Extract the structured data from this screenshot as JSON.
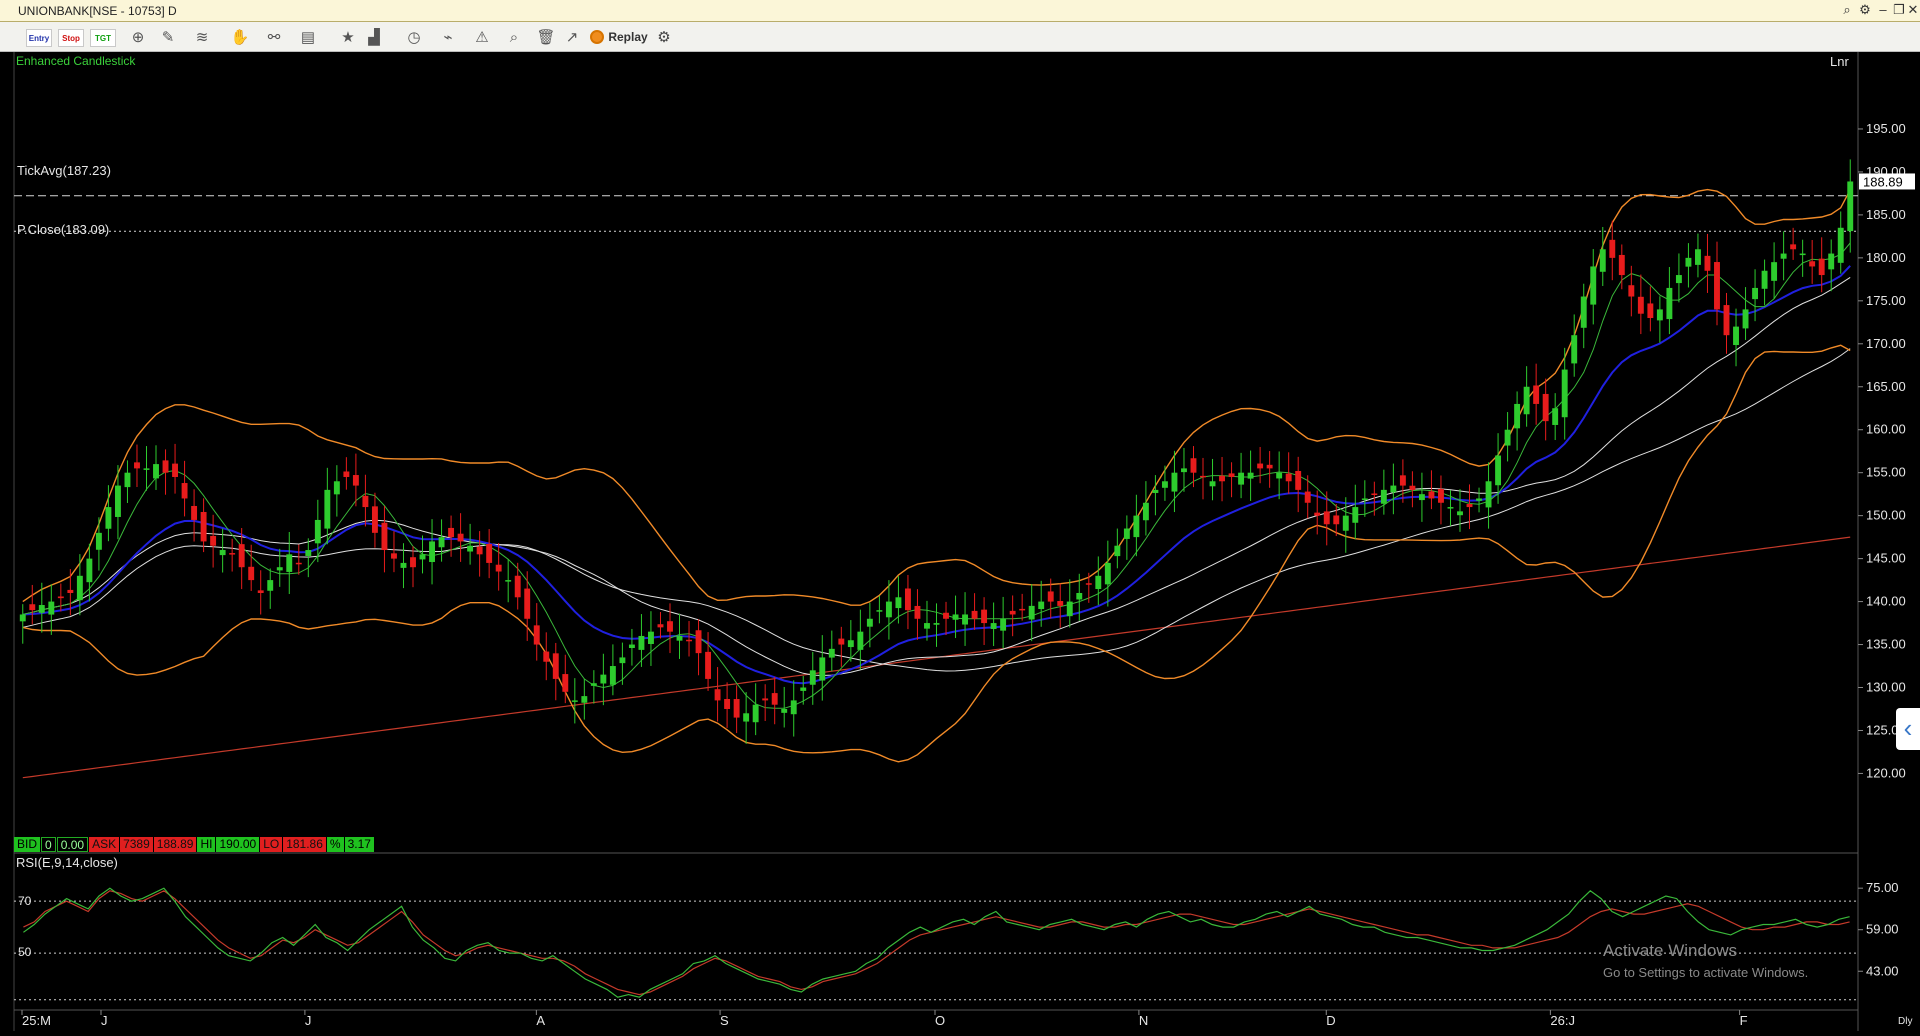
{
  "window": {
    "title": "UNIONBANK[NSE - 10753] D",
    "controls": [
      "search-icon",
      "settings-icon",
      "minimize-icon",
      "restore-icon",
      "close-icon"
    ]
  },
  "toolbar": {
    "entry_label": "Entry",
    "stop_label": "Stop",
    "target_label": "TGT",
    "replay_label": "Replay",
    "icons": [
      "crosshair-icon",
      "draw-line-icon",
      "fib-icon",
      "pan-icon",
      "link-icon",
      "template-icon",
      "favorite-icon",
      "indicator-icon",
      "clock-icon",
      "signal-icon",
      "alert-icon",
      "zoom-icon",
      "delete-icon",
      "trend-icon",
      "settings-gear-icon"
    ]
  },
  "chart_header": {
    "study_title": "Enhanced Candlestick",
    "scale_mode": "Lnr",
    "tick_avg_label": "TickAvg(187.23)",
    "prev_close_label": "P.Close(183.09)",
    "last_price_tag": "188.89"
  },
  "quote": {
    "bid_label": "BID",
    "bid_qty": "0",
    "bid_price": "0.00",
    "ask_label": "ASK",
    "ask_qty": "7389",
    "ask_price": "188.89",
    "hi_label": "HI",
    "hi_value": "190.00",
    "lo_label": "LO",
    "lo_value": "181.86",
    "pct_label": "%",
    "pct_value": "3.17"
  },
  "rsi": {
    "label": "RSI(E,9,14,close)",
    "level_70_label": "70",
    "level_50_label": "50"
  },
  "watermark": {
    "line1": "Activate Windows",
    "line2": "Go to Settings to activate Windows."
  },
  "timeframe_badge": "Dly",
  "colors": {
    "up": "#2ecc2e",
    "down": "#e81c1c",
    "bollinger": "#f08a28",
    "ema_blue": "#2020e0",
    "ma_white": "#e0e0e0",
    "ma_green": "#3ab83a",
    "ma_long_red": "#c43a2a",
    "rsi_green": "#3ab83a",
    "rsi_red": "#c43a2a"
  },
  "chart_data": [
    {
      "type": "candlestick",
      "y_ticks": [
        "120.00",
        "125.00",
        "130.00",
        "135.00",
        "140.00",
        "145.00",
        "150.00",
        "155.00",
        "160.00",
        "165.00",
        "170.00",
        "175.00",
        "180.00",
        "185.00",
        "190.00",
        "195.00"
      ],
      "ylim": [
        114,
        200
      ],
      "x_ticks": [
        "25:M",
        "J",
        "J",
        "A",
        "S",
        "O",
        "N",
        "D",
        "26:J",
        "F"
      ],
      "reference_lines": {
        "tick_avg": 187.23,
        "prev_close": 183.09
      },
      "close": [
        138.5,
        139.0,
        139.6,
        140.0,
        140.4,
        141.0,
        143.0,
        145.0,
        148.0,
        151.0,
        153.5,
        155.0,
        155.5,
        155.5,
        156.0,
        155.0,
        154.5,
        152.0,
        149.5,
        147.0,
        146.5,
        146.0,
        145.5,
        144.0,
        142.5,
        141.0,
        142.5,
        144.0,
        145.5,
        144.5,
        146.0,
        149.5,
        153.0,
        154.0,
        154.5,
        153.5,
        151.0,
        148.0,
        146.0,
        145.0,
        144.5,
        144.0,
        145.5,
        147.0,
        147.5,
        147.5,
        147.0,
        146.5,
        145.5,
        144.5,
        143.5,
        142.5,
        140.5,
        138.0,
        135.0,
        133.0,
        131.0,
        129.5,
        128.5,
        129.0,
        130.5,
        131.5,
        132.5,
        133.5,
        135.0,
        136.0,
        136.5,
        137.0,
        136.5,
        136.0,
        135.5,
        134.0,
        131.0,
        128.5,
        127.5,
        126.5,
        127.0,
        128.0,
        128.5,
        128.0,
        127.5,
        128.5,
        130.0,
        132.0,
        133.5,
        134.5,
        135.0,
        135.5,
        136.5,
        138.0,
        139.0,
        140.0,
        140.5,
        139.0,
        138.0,
        137.5,
        137.5,
        138.0,
        138.5,
        138.5,
        138.0,
        137.5,
        137.5,
        138.0,
        138.5,
        139.0,
        139.5,
        140.0,
        140.0,
        139.5,
        140.0,
        141.0,
        142.0,
        143.0,
        144.5,
        146.5,
        148.5,
        150.0,
        151.5,
        153.0,
        154.0,
        155.0,
        155.5,
        155.0,
        154.5,
        154.0,
        154.0,
        154.5,
        155.0,
        155.0,
        155.5,
        155.5,
        155.0,
        154.0,
        153.0,
        151.5,
        150.0,
        149.0,
        149.0,
        150.0,
        151.0,
        152.0,
        152.5,
        153.0,
        153.5,
        153.5,
        153.0,
        152.5,
        152.0,
        151.5,
        151.0,
        150.5,
        151.0,
        152.0,
        154.0,
        157.0,
        160.0,
        163.0,
        165.0,
        163.0,
        161.0,
        162.5,
        167.0,
        171.0,
        175.5,
        179.0,
        181.0,
        180.0,
        178.0,
        175.5,
        173.5,
        173.0,
        174.0,
        176.5,
        178.0,
        180.0,
        181.0,
        178.5,
        174.0,
        171.0,
        172.0,
        174.0,
        176.5,
        178.5,
        179.5,
        180.5,
        181.0,
        180.5,
        179.0,
        178.0,
        180.5,
        183.5,
        188.89
      ],
      "overlays": [
        "Bollinger Bands (orange)",
        "EMA (blue)",
        "Moving averages (white)",
        "Short MA (green)",
        "Long MA (red)"
      ]
    },
    {
      "type": "line",
      "title": "RSI(E,9,14,close)",
      "y_ticks": [
        "43.00",
        "59.00",
        "75.00"
      ],
      "ylim": [
        30,
        82
      ],
      "levels": [
        70,
        50
      ],
      "series": [
        {
          "values": [
            60,
            62,
            66,
            68,
            70,
            68,
            66,
            71,
            74,
            73,
            71,
            70,
            72,
            74,
            71,
            67,
            63,
            59,
            55,
            52,
            50,
            48,
            49,
            52,
            55,
            54,
            56,
            59,
            57,
            55,
            53,
            54,
            57,
            60,
            63,
            66,
            62,
            57,
            54,
            51,
            49,
            50,
            52,
            53,
            52,
            51,
            50,
            49,
            48,
            48,
            47,
            45,
            42,
            40,
            38,
            36,
            35,
            34,
            35,
            37,
            39,
            41,
            44,
            46,
            48,
            47,
            45,
            43,
            41,
            40,
            39,
            37,
            36,
            37,
            39,
            40,
            41,
            42,
            44,
            46,
            49,
            52,
            55,
            57,
            58,
            59,
            60,
            61,
            62,
            63,
            64,
            63,
            62,
            61,
            60,
            60,
            61,
            62,
            62,
            61,
            60,
            60,
            61,
            61,
            62,
            63,
            64,
            65,
            65,
            64,
            63,
            62,
            61,
            61,
            62,
            63,
            64,
            65,
            66,
            67,
            66,
            65,
            64,
            63,
            62,
            61,
            60,
            59,
            58,
            57,
            57,
            56,
            55,
            54,
            53,
            53,
            52,
            52,
            52,
            53,
            54,
            55,
            56,
            58,
            61,
            64,
            66,
            67,
            66,
            65,
            65,
            66,
            67,
            68,
            69,
            68,
            66,
            64,
            62,
            60,
            59,
            59,
            60,
            60,
            61,
            62,
            62,
            61,
            61,
            62
          ]
        },
        {
          "values": [
            58,
            61,
            65,
            68,
            71,
            69,
            67,
            72,
            75,
            72,
            70,
            71,
            73,
            75,
            70,
            64,
            60,
            56,
            52,
            49,
            48,
            47,
            50,
            54,
            56,
            53,
            57,
            61,
            56,
            54,
            51,
            55,
            59,
            62,
            65,
            68,
            60,
            55,
            52,
            48,
            47,
            51,
            53,
            54,
            51,
            50,
            50,
            48,
            47,
            49,
            46,
            43,
            40,
            38,
            36,
            33,
            34,
            33,
            36,
            38,
            40,
            42,
            46,
            47,
            49,
            46,
            44,
            42,
            40,
            39,
            38,
            36,
            35,
            38,
            40,
            41,
            42,
            43,
            46,
            48,
            52,
            55,
            58,
            60,
            58,
            60,
            62,
            63,
            61,
            64,
            66,
            62,
            61,
            60,
            59,
            61,
            62,
            63,
            61,
            60,
            59,
            61,
            62,
            60,
            63,
            65,
            66,
            64,
            62,
            63,
            61,
            60,
            60,
            62,
            63,
            65,
            66,
            64,
            66,
            68,
            65,
            64,
            63,
            61,
            60,
            60,
            58,
            57,
            56,
            56,
            55,
            54,
            53,
            52,
            52,
            51,
            51,
            52,
            53,
            55,
            57,
            59,
            62,
            65,
            70,
            74,
            71,
            66,
            64,
            66,
            68,
            70,
            72,
            71,
            66,
            62,
            59,
            58,
            57,
            59,
            60,
            61,
            61,
            62,
            63,
            61,
            60,
            61,
            63,
            64
          ]
        }
      ]
    }
  ]
}
